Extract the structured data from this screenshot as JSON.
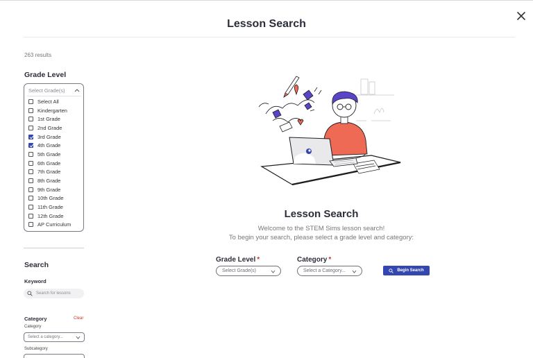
{
  "modal": {
    "title": "Lesson Search",
    "close_icon": "close-icon"
  },
  "sidebar": {
    "results_count": "263 results",
    "grade_level": {
      "heading": "Grade Level",
      "placeholder": "Select Grade(s)",
      "options": [
        {
          "label": "Select All",
          "checked": false
        },
        {
          "label": "Kindergarten",
          "checked": false
        },
        {
          "label": "1st Grade",
          "checked": false
        },
        {
          "label": "2nd Grade",
          "checked": false
        },
        {
          "label": "3rd Grade",
          "checked": true
        },
        {
          "label": "4th Grade",
          "checked": true
        },
        {
          "label": "5th Grade",
          "checked": false
        },
        {
          "label": "6th Grade",
          "checked": false
        },
        {
          "label": "7th Grade",
          "checked": false
        },
        {
          "label": "8th Grade",
          "checked": false
        },
        {
          "label": "9th Grade",
          "checked": false
        },
        {
          "label": "10th Grade",
          "checked": false
        },
        {
          "label": "11th Grade",
          "checked": false
        },
        {
          "label": "12th Grade",
          "checked": false
        },
        {
          "label": "AP Curriculum",
          "checked": false
        }
      ]
    },
    "search": {
      "heading": "Search",
      "keyword_label": "Keyword",
      "keyword_placeholder": "Search for lessons"
    },
    "category": {
      "heading": "Category",
      "clear_label": "Clear",
      "category_label": "Category",
      "category_placeholder": "Select a category...",
      "subcategory_label": "Subcategory"
    }
  },
  "main": {
    "title": "Lesson Search",
    "subtitle_line1": "Welcome to the STEM Sims lesson search!",
    "subtitle_line2": "To begin your search, please select a grade level and category:",
    "grade_label": "Grade Level",
    "grade_placeholder": "Select Grade(s)",
    "category_label": "Category",
    "category_placeholder": "Select a Category...",
    "required_mark": "*",
    "begin_button": "Begin Search"
  },
  "colors": {
    "accent": "#3447b0",
    "required": "#c0392b",
    "illustration_shirt": "#ee6a55"
  }
}
